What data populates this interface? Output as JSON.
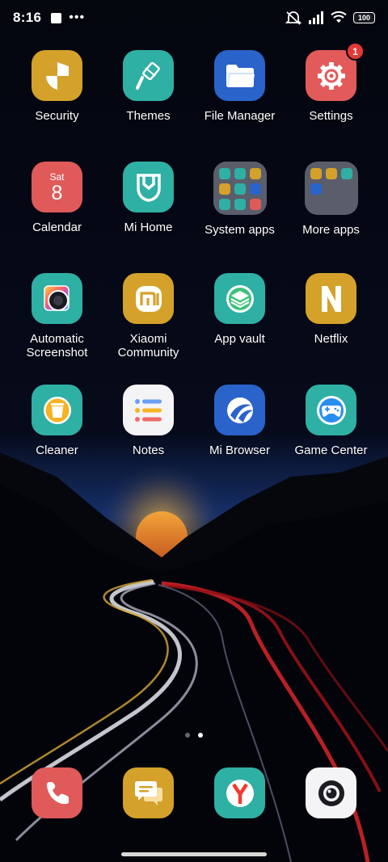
{
  "status_bar": {
    "time": "8:16",
    "dots": "•••",
    "battery": "100"
  },
  "apps": [
    {
      "label": "Security",
      "icon": "shield-icon",
      "color": "#d4a12a"
    },
    {
      "label": "Themes",
      "icon": "paintbrush-icon",
      "color": "#2fb0a4"
    },
    {
      "label": "File Manager",
      "icon": "folder-icon",
      "color": "#2a63c9"
    },
    {
      "label": "Settings",
      "icon": "gear-icon",
      "color": "#e25a5a",
      "badge": "1"
    },
    {
      "label": "Calendar",
      "icon": "calendar-icon",
      "color": "#e05a5a",
      "day": "Sat",
      "date": "8"
    },
    {
      "label": "Mi Home",
      "icon": "mi-home-icon",
      "color": "#2fb0a4"
    },
    {
      "label": "System apps",
      "icon": "folder-icon"
    },
    {
      "label": "More apps",
      "icon": "folder-icon"
    },
    {
      "label": "Automatic\nScreenshot",
      "icon": "screenshot-icon",
      "color": "#2fb0a4"
    },
    {
      "label": "Xiaomi\nCommunity",
      "icon": "mi-logo-icon",
      "color": "#d4a12a"
    },
    {
      "label": "App vault",
      "icon": "layers-icon",
      "color": "#2fb0a4"
    },
    {
      "label": "Netflix",
      "icon": "netflix-icon",
      "color": "#d4a12a"
    },
    {
      "label": "Cleaner",
      "icon": "trash-icon",
      "color": "#2fb0a4"
    },
    {
      "label": "Notes",
      "icon": "notes-icon",
      "color": "#f4f4f6"
    },
    {
      "label": "Mi Browser",
      "icon": "browser-icon",
      "color": "#2a63c9"
    },
    {
      "label": "Game Center",
      "icon": "gamepad-icon",
      "color": "#2fb0a4"
    }
  ],
  "dock": [
    {
      "name": "phone",
      "icon": "phone-icon",
      "color": "#e05a5a"
    },
    {
      "name": "messaging",
      "icon": "chat-icon",
      "color": "#d4a12a"
    },
    {
      "name": "yandex",
      "icon": "yandex-icon",
      "color": "#2fb0a4"
    },
    {
      "name": "camera",
      "icon": "camera-icon",
      "color": "#f4f4f6"
    }
  ],
  "pages": {
    "count": 2,
    "active": 2
  }
}
